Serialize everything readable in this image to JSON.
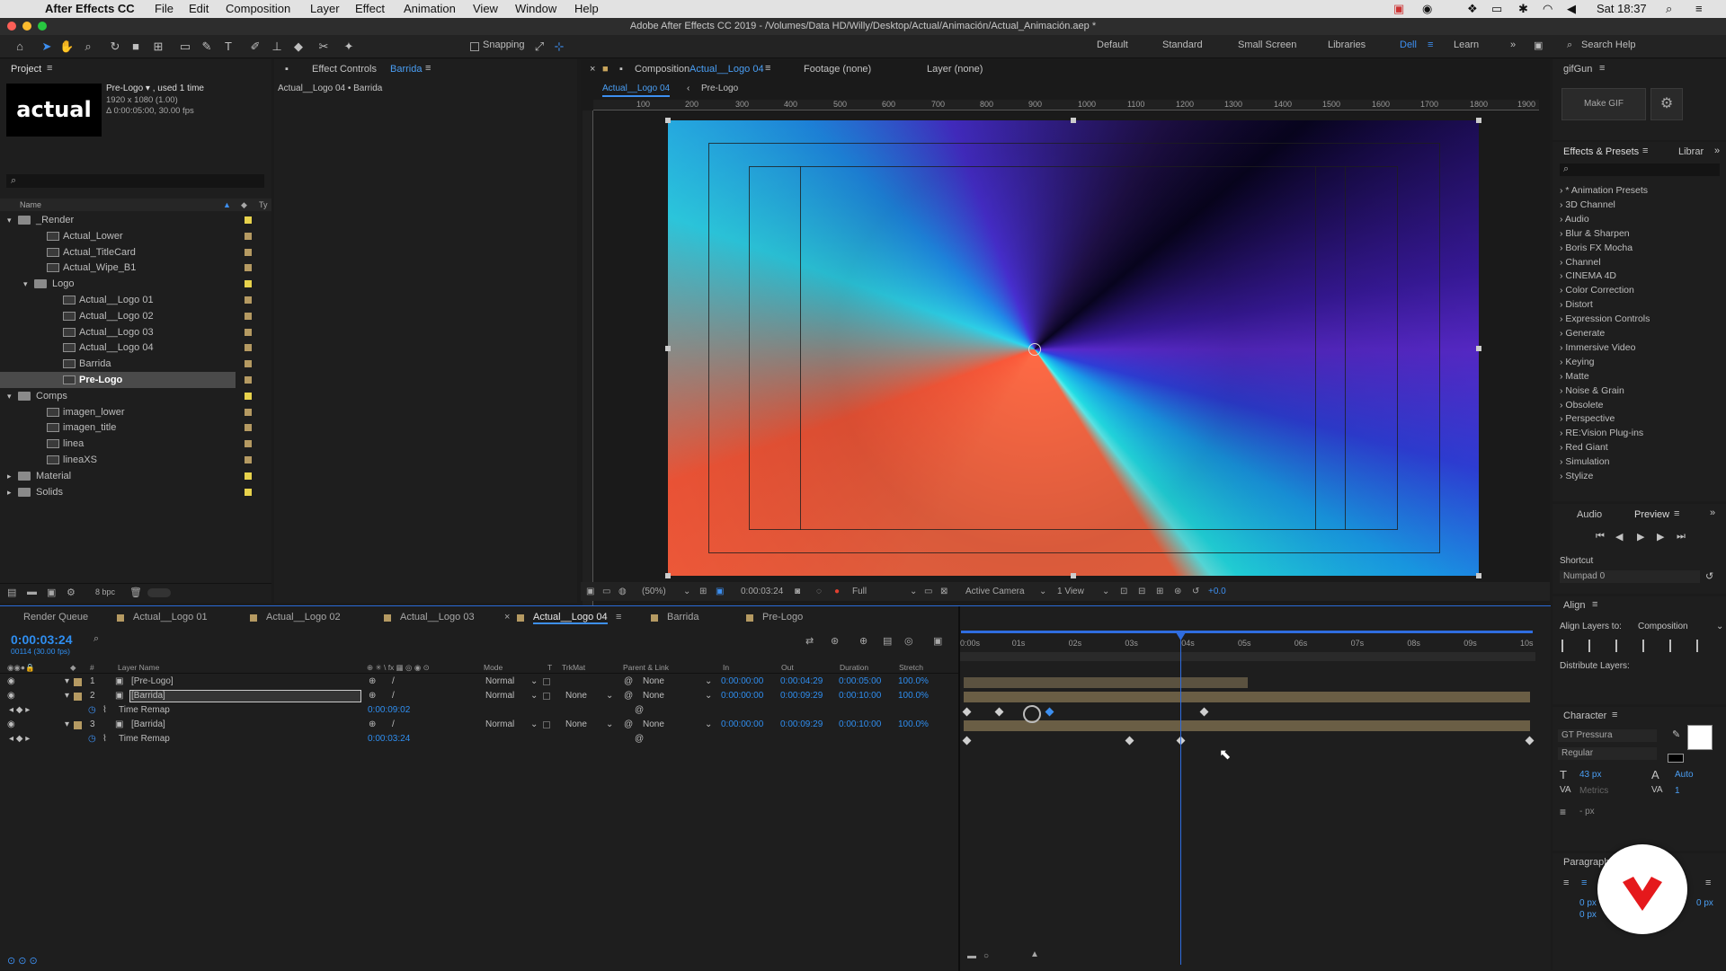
{
  "menubar": {
    "app": "After Effects CC",
    "items": [
      "File",
      "Edit",
      "Composition",
      "Layer",
      "Effect",
      "Animation",
      "View",
      "Window",
      "Help"
    ],
    "clock": "Sat 18:37"
  },
  "titlebar": {
    "text": "Adobe After Effects CC 2019 - /Volumes/Data HD/Willy/Desktop/Actual/Animación/Actual_Animación.aep *"
  },
  "toolbar": {
    "snapping": "Snapping",
    "workspaces": [
      "Default",
      "Standard",
      "Small Screen",
      "Libraries",
      "Dell",
      "Learn"
    ],
    "active_workspace": "Dell",
    "search_placeholder": "Search Help"
  },
  "project": {
    "tab": "Project",
    "thumb_text": "actual",
    "selected_name": "Pre-Logo ▾ , used 1 time",
    "selected_info1": "1920 x 1080 (1.00)",
    "selected_info2": "Δ 0:00:05:00, 30.00 fps",
    "col_name": "Name",
    "col_type": "Ty",
    "bpc": "8 bpc",
    "tree": [
      {
        "label": "_Render",
        "kind": "folder",
        "indent": 0,
        "open": true
      },
      {
        "label": "Actual_Lower",
        "kind": "comp",
        "indent": 1
      },
      {
        "label": "Actual_TitleCard",
        "kind": "comp",
        "indent": 1
      },
      {
        "label": "Actual_Wipe_B1",
        "kind": "comp",
        "indent": 1
      },
      {
        "label": "Logo",
        "kind": "folder",
        "indent": 1,
        "open": true
      },
      {
        "label": "Actual__Logo 01",
        "kind": "comp",
        "indent": 2
      },
      {
        "label": "Actual__Logo 02",
        "kind": "comp",
        "indent": 2
      },
      {
        "label": "Actual__Logo 03",
        "kind": "comp",
        "indent": 2
      },
      {
        "label": "Actual__Logo 04",
        "kind": "comp",
        "indent": 2
      },
      {
        "label": "Barrida",
        "kind": "comp",
        "indent": 2
      },
      {
        "label": "Pre-Logo",
        "kind": "comp",
        "indent": 2,
        "selected": true
      },
      {
        "label": "Comps",
        "kind": "folder",
        "indent": 0,
        "open": true
      },
      {
        "label": "imagen_lower",
        "kind": "comp",
        "indent": 1
      },
      {
        "label": "imagen_title",
        "kind": "comp",
        "indent": 1
      },
      {
        "label": "linea",
        "kind": "comp",
        "indent": 1
      },
      {
        "label": "lineaXS",
        "kind": "comp",
        "indent": 1
      },
      {
        "label": "Material",
        "kind": "folder",
        "indent": 0,
        "open": false
      },
      {
        "label": "Solids",
        "kind": "folder",
        "indent": 0,
        "open": false
      }
    ]
  },
  "effect_controls": {
    "tab": "Effect Controls",
    "layer": "Barrida",
    "subtitle": "Actual__Logo 04 • Barrida"
  },
  "comp_viewer": {
    "tab_prefix": "Composition",
    "tab_name": "Actual__Logo 04",
    "footage_tab": "Footage (none)",
    "layer_tab": "Layer (none)",
    "breadcrumb": [
      "Actual__Logo 04",
      "Pre-Logo"
    ],
    "ruler": [
      "100",
      "200",
      "300",
      "400",
      "500",
      "600",
      "700",
      "800",
      "900",
      "1000",
      "1100",
      "1200",
      "1300",
      "1400",
      "1500",
      "1600",
      "1700",
      "1800",
      "1900"
    ],
    "zoom": "(50%)",
    "timecode": "0:00:03:24",
    "resolution": "Full",
    "camera": "Active Camera",
    "view": "1 View",
    "exposure": "+0.0"
  },
  "gifgun": {
    "tab": "gifGun",
    "button": "Make GIF"
  },
  "effects_presets": {
    "tab": "Effects & Presets",
    "tab2": "Librar",
    "items": [
      "* Animation Presets",
      "3D Channel",
      "Audio",
      "Blur & Sharpen",
      "Boris FX Mocha",
      "Channel",
      "CINEMA 4D",
      "Color Correction",
      "Distort",
      "Expression Controls",
      "Generate",
      "Immersive Video",
      "Keying",
      "Matte",
      "Noise & Grain",
      "Obsolete",
      "Perspective",
      "RE:Vision Plug-ins",
      "Red Giant",
      "Simulation",
      "Stylize"
    ]
  },
  "preview": {
    "tab_audio": "Audio",
    "tab_preview": "Preview",
    "shortcut_label": "Shortcut",
    "shortcut_value": "Numpad 0"
  },
  "align": {
    "tab": "Align",
    "align_to_label": "Align Layers to:",
    "align_to_value": "Composition",
    "distribute": "Distribute Layers:"
  },
  "character": {
    "tab": "Character",
    "font": "GT Pressura",
    "style": "Regular",
    "size": "43 px",
    "leading": "Auto",
    "kerning": "Metrics",
    "tracking": "1",
    "stroke": "- px"
  },
  "paragraph": {
    "tab": "Paragraph",
    "indent1": "0 px",
    "indent2": "0 px",
    "indent3": "0 px"
  },
  "timeline": {
    "tabs": [
      "Render Queue",
      "Actual__Logo 01",
      "Actual__Logo 02",
      "Actual__Logo 03",
      "Actual__Logo 04",
      "Barrida",
      "Pre-Logo"
    ],
    "active_tab": "Actual__Logo 04",
    "timecode": "0:00:03:24",
    "frames": "00114 (30.00 fps)",
    "headers": {
      "layer_name": "Layer Name",
      "mode": "Mode",
      "t": "T",
      "trkmat": "TrkMat",
      "parent": "Parent & Link",
      "in": "In",
      "out": "Out",
      "duration": "Duration",
      "stretch": "Stretch"
    },
    "ruler": [
      "0:00s",
      "01s",
      "02s",
      "03s",
      "04s",
      "05s",
      "06s",
      "07s",
      "08s",
      "09s",
      "10s"
    ],
    "layers": [
      {
        "num": "1",
        "name": "[Pre-Logo]",
        "mode": "Normal",
        "trkmat": "",
        "parent": "None",
        "in": "0:00:00:00",
        "out": "0:00:04:29",
        "duration": "0:00:05:00",
        "stretch": "100.0%"
      },
      {
        "num": "2",
        "name": "[Barrida]",
        "mode": "Normal",
        "trkmat": "None",
        "parent": "None",
        "in": "0:00:00:00",
        "out": "0:00:09:29",
        "duration": "0:00:10:00",
        "stretch": "100.0%"
      },
      {
        "prop": "Time Remap",
        "value": "0:00:09:02"
      },
      {
        "num": "3",
        "name": "[Barrida]",
        "mode": "Normal",
        "trkmat": "None",
        "parent": "None",
        "in": "0:00:00:00",
        "out": "0:00:09:29",
        "duration": "0:00:10:00",
        "stretch": "100.0%"
      },
      {
        "prop": "Time Remap",
        "value": "0:00:03:24"
      }
    ]
  },
  "colors": {
    "accent": "#2f8ef0",
    "label_yellow": "#e7d24c",
    "label_tan": "#b59a62",
    "viewer_orange": "#ff6a45",
    "viewer_cyan": "#2ff0f0",
    "viewer_violet": "#6a2bd9"
  }
}
